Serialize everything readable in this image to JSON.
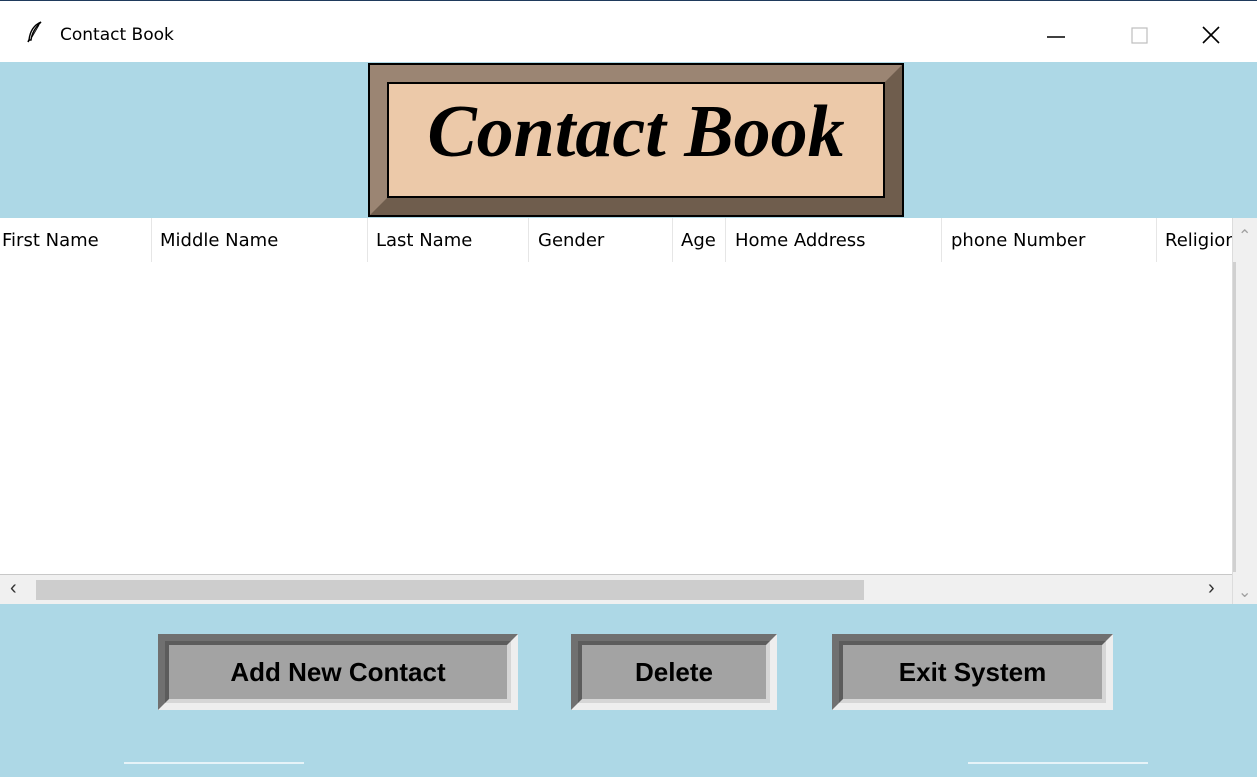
{
  "window": {
    "title": "Contact Book",
    "icons": {
      "app": "feather-icon",
      "minimize": "minimize-icon",
      "maximize": "maximize-icon",
      "close": "close-icon"
    }
  },
  "header": {
    "title": "Contact Book"
  },
  "table": {
    "columns": [
      "First Name",
      "Middle Name",
      "Last Name",
      "Gender",
      "Age",
      "Home Address",
      "phone Number",
      "Religion"
    ],
    "rows": []
  },
  "buttons": {
    "add": "Add New Contact",
    "delete": "Delete",
    "exit": "Exit System"
  },
  "colors": {
    "background": "#add8e6",
    "title_fill": "#ecc9a9",
    "title_border": "#8b7563",
    "button_fill": "#a3a3a3"
  }
}
